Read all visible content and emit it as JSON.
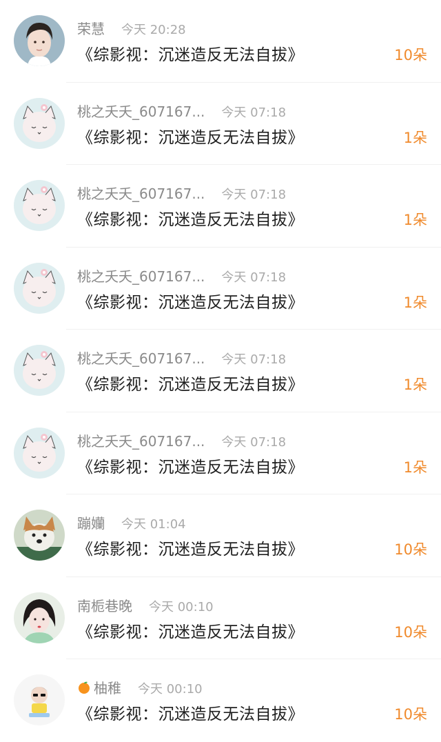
{
  "items": [
    {
      "name": "荣慧",
      "time": "今天 20:28",
      "title": "《综影视：沉迷造反无法自拔》",
      "count": "10朵",
      "avatar": "avatar-man"
    },
    {
      "name": "桃之夭夭_607167...",
      "time": "今天 07:18",
      "title": "《综影视：沉迷造反无法自拔》",
      "count": "1朵",
      "avatar": "avatar-cat"
    },
    {
      "name": "桃之夭夭_607167...",
      "time": "今天 07:18",
      "title": "《综影视：沉迷造反无法自拔》",
      "count": "1朵",
      "avatar": "avatar-cat"
    },
    {
      "name": "桃之夭夭_607167...",
      "time": "今天 07:18",
      "title": "《综影视：沉迷造反无法自拔》",
      "count": "1朵",
      "avatar": "avatar-cat"
    },
    {
      "name": "桃之夭夭_607167...",
      "time": "今天 07:18",
      "title": "《综影视：沉迷造反无法自拔》",
      "count": "1朵",
      "avatar": "avatar-cat"
    },
    {
      "name": "桃之夭夭_607167...",
      "time": "今天 07:18",
      "title": "《综影视：沉迷造反无法自拔》",
      "count": "1朵",
      "avatar": "avatar-cat"
    },
    {
      "name": "蹦孏",
      "time": "今天 01:04",
      "title": "《综影视：沉迷造反无法自拔》",
      "count": "10朵",
      "avatar": "avatar-dog"
    },
    {
      "name": "南栀巷晚",
      "time": "今天 00:10",
      "title": "《综影视：沉迷造反无法自拔》",
      "count": "10朵",
      "avatar": "avatar-girl"
    },
    {
      "name": "柚稚",
      "time": "今天 00:10",
      "title": "《综影视：沉迷造反无法自拔》",
      "count": "10朵",
      "avatar": "avatar-cartoon",
      "name_emoji": "tangerine-icon"
    }
  ],
  "colors": {
    "count": "#f08a2c",
    "name": "#8a8a8a",
    "time": "#aaaaaa",
    "title": "#1f1f1f"
  }
}
